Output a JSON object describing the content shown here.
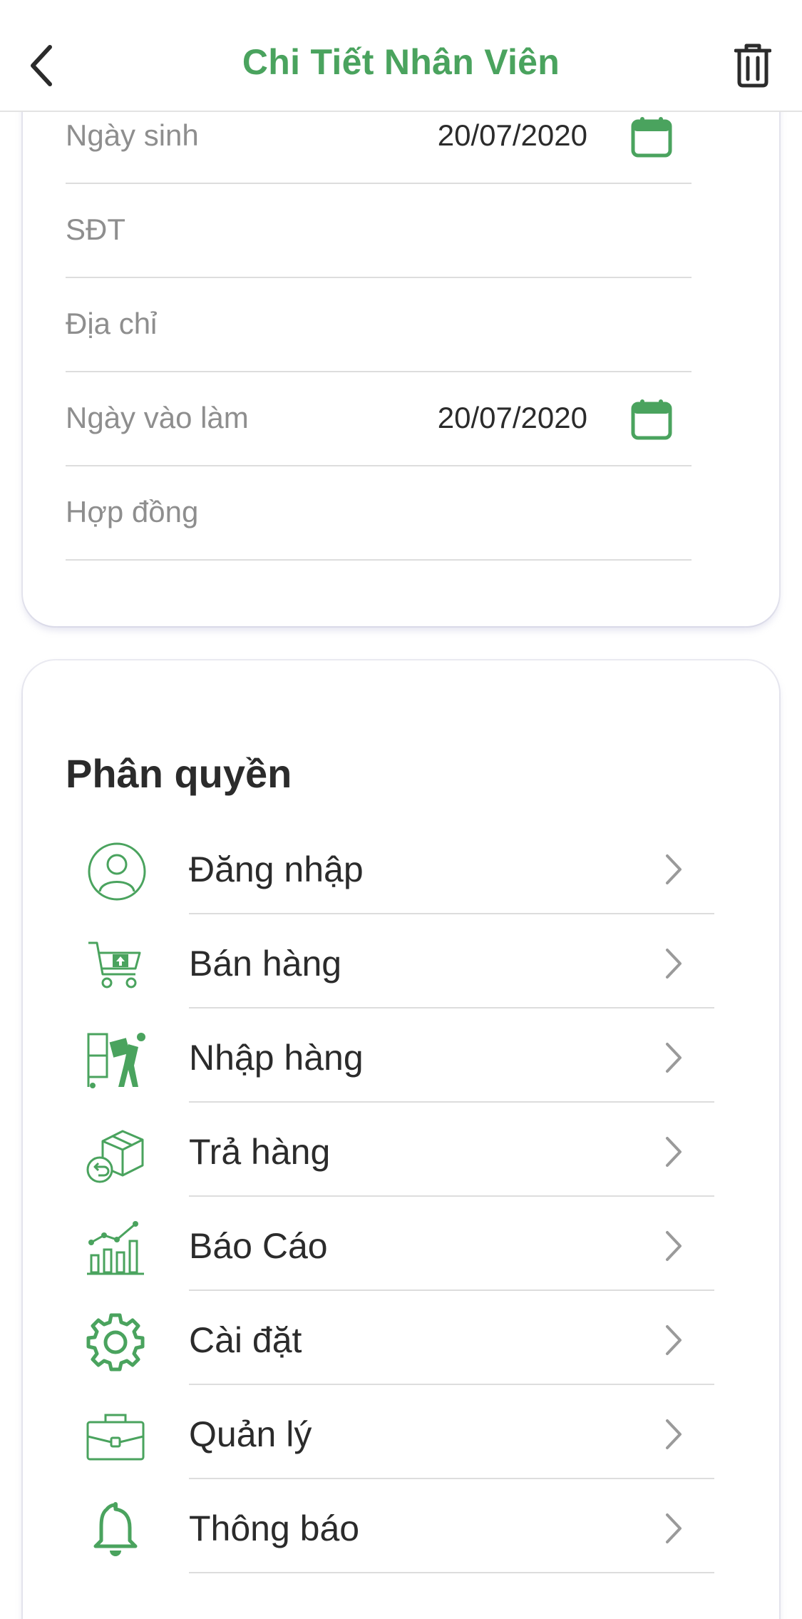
{
  "header": {
    "title": "Chi Tiết Nhân Viên",
    "back_icon": "chevron-left-icon",
    "delete_icon": "trash-icon"
  },
  "info_form": {
    "fields": [
      {
        "label": "Ngày sinh",
        "value": "20/07/2020",
        "has_calendar": true
      },
      {
        "label": "SĐT",
        "value": "",
        "has_calendar": false
      },
      {
        "label": "Địa chỉ",
        "value": "",
        "has_calendar": false
      },
      {
        "label": "Ngày vào làm",
        "value": "20/07/2020",
        "has_calendar": true
      },
      {
        "label": "Hợp đồng",
        "value": "",
        "has_calendar": false
      }
    ]
  },
  "permissions": {
    "title": "Phân quyền",
    "items": [
      {
        "label": "Đăng nhập",
        "icon": "user-circle-icon"
      },
      {
        "label": "Bán hàng",
        "icon": "shopping-cart-icon"
      },
      {
        "label": "Nhập hàng",
        "icon": "delivery-worker-icon"
      },
      {
        "label": "Trả hàng",
        "icon": "return-box-icon"
      },
      {
        "label": "Báo Cáo",
        "icon": "chart-icon"
      },
      {
        "label": "Cài đặt",
        "icon": "gear-icon"
      },
      {
        "label": "Quản lý",
        "icon": "briefcase-icon"
      },
      {
        "label": "Thông báo",
        "icon": "bell-icon"
      }
    ]
  },
  "colors": {
    "accent": "#4aa35e",
    "text": "#2b2b2b",
    "muted": "#8e8e8e",
    "divider": "#dddddd",
    "chevron": "#9a9a9a"
  }
}
